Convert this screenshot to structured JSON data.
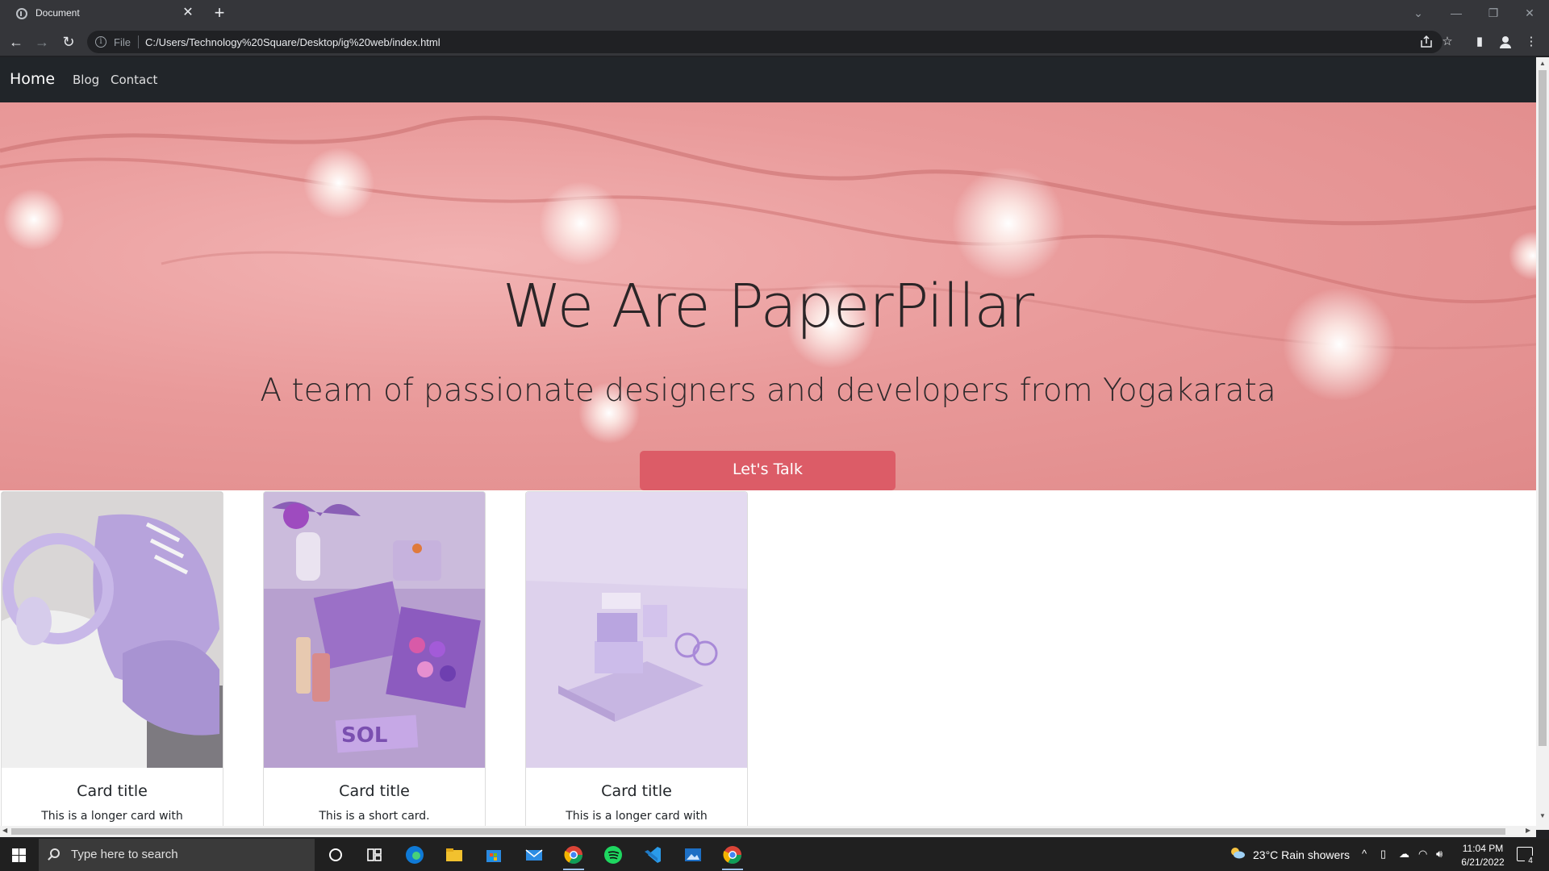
{
  "browser": {
    "tab_title": "Document",
    "tab_close": "✕",
    "new_tab": "+",
    "scheme_label": "File",
    "url": "C:/Users/Technology%20Square/Desktop/ig%20web/index.html",
    "back": "←",
    "forward": "→",
    "reload": "↻"
  },
  "site": {
    "nav": {
      "brand": "Home",
      "items": [
        "Blog",
        "Contact"
      ]
    },
    "hero": {
      "title": "We Are PaperPillar",
      "subtitle": "A team of passionate designers and developers from Yogakarata",
      "cta": "Let's Talk"
    },
    "cards": [
      {
        "title": "Card title",
        "text": "This is a longer card with"
      },
      {
        "title": "Card title",
        "text": "This is a short card."
      },
      {
        "title": "Card title",
        "text": "This is a longer card with"
      }
    ],
    "colors": {
      "navbar": "#212529",
      "hero_pink": "#e99a9a",
      "cta": "#dc5c67",
      "lavender": "#b8a3e0"
    }
  },
  "taskbar": {
    "search_placeholder": "Type here to search",
    "weather": "23°C  Rain showers",
    "time": "11:04 PM",
    "date": "6/21/2022",
    "notification_count": "4",
    "apps": [
      "cortana-icon",
      "task-view-icon",
      "edge-icon",
      "file-explorer-icon",
      "store-icon",
      "mail-icon",
      "chrome-icon",
      "spotify-icon",
      "vscode-icon",
      "photos-icon",
      "chrome-alt-icon"
    ]
  }
}
